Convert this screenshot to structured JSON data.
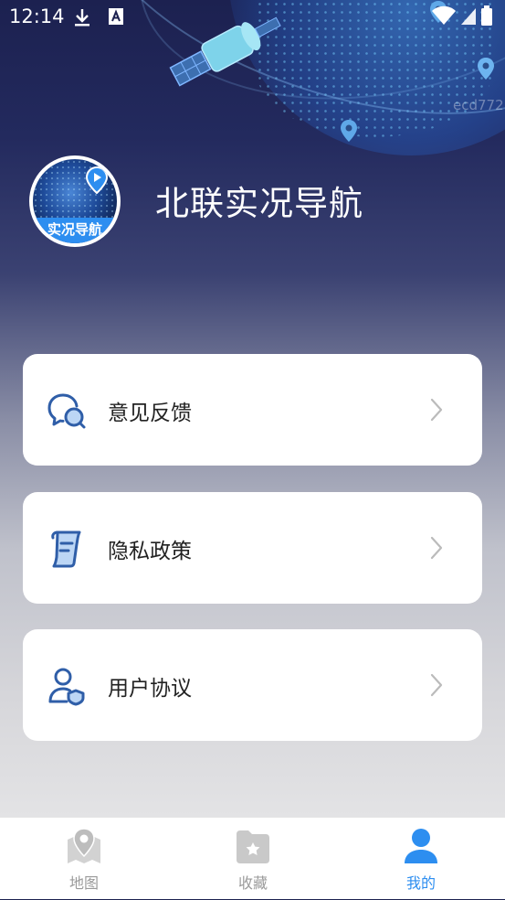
{
  "status_bar": {
    "time": "12:14"
  },
  "hero": {
    "watermark": "ecd772"
  },
  "profile": {
    "avatar_label": "实况导航",
    "app_title": "北联实况导航"
  },
  "menu": {
    "items": [
      {
        "label": "意见反馈",
        "icon": "feedback-chat-icon"
      },
      {
        "label": "隐私政策",
        "icon": "document-icon"
      },
      {
        "label": "用户协议",
        "icon": "user-shield-icon"
      }
    ]
  },
  "bottom_nav": {
    "items": [
      {
        "label": "地图",
        "icon": "map-pin-icon",
        "active": false
      },
      {
        "label": "收藏",
        "icon": "folder-star-icon",
        "active": false
      },
      {
        "label": "我的",
        "icon": "person-icon",
        "active": true
      }
    ]
  },
  "colors": {
    "accent": "#2d8ef0",
    "icon_blue": "#2f5ea8",
    "inactive": "#9a9a9a",
    "card_bg": "#ffffff"
  }
}
